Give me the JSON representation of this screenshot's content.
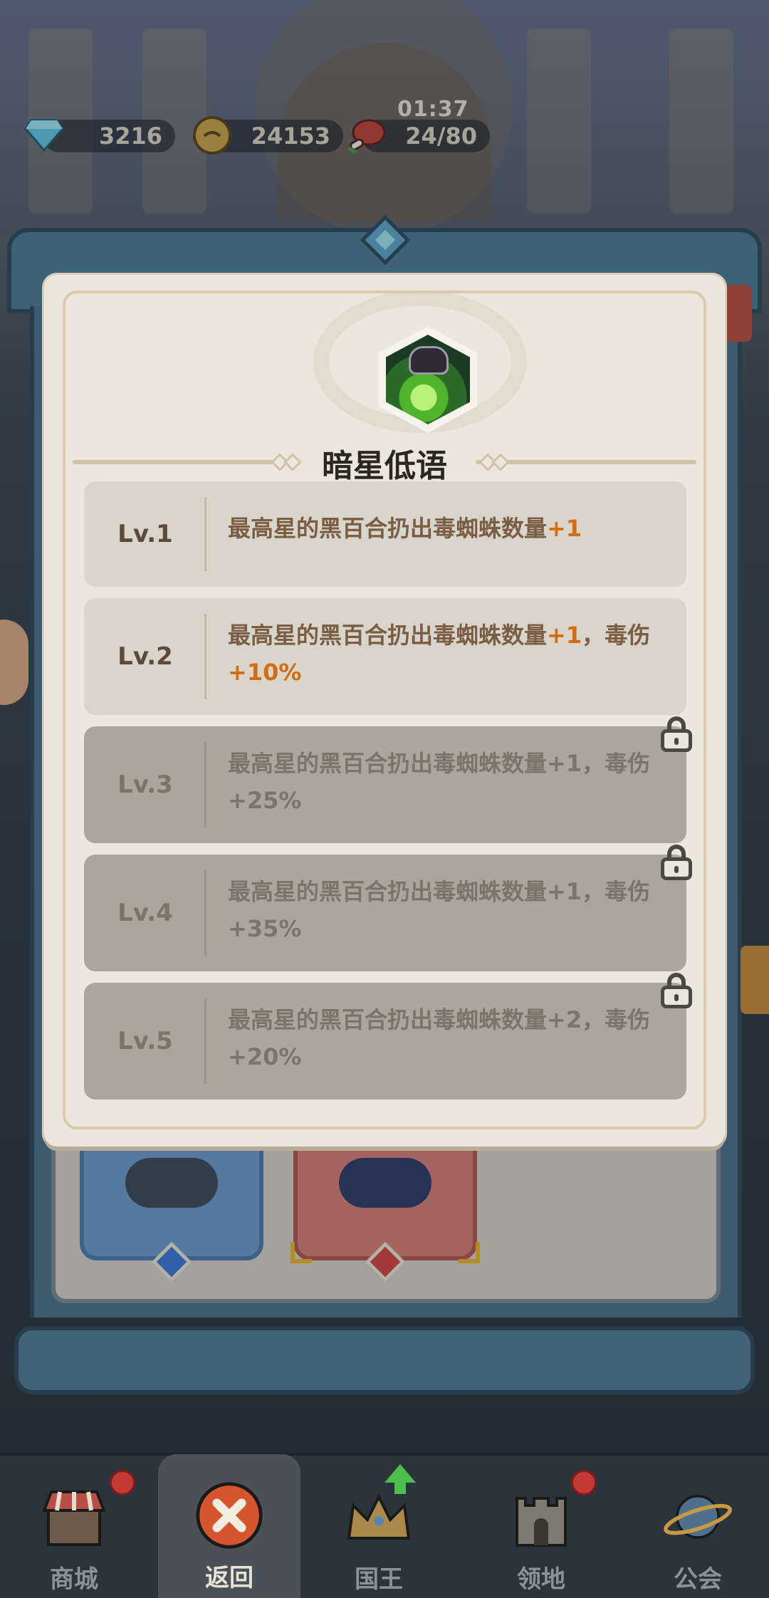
{
  "status": {
    "timer": "01:37",
    "gems": "3216",
    "coins": "24153",
    "stamina": "24/80"
  },
  "skill": {
    "title": "暗星低语",
    "icon": "dark-lily-skill-icon",
    "levels": [
      {
        "label": "Lv.1",
        "text": "最高星的黑百合扔出毒蜘蛛数量",
        "bonus": "+1",
        "tail_sep": "",
        "tail": "",
        "tail_bonus": "",
        "locked": false
      },
      {
        "label": "Lv.2",
        "text": "最高星的黑百合扔出毒蜘蛛数量",
        "bonus": "+1",
        "tail_sep": "，毒伤",
        "tail": "",
        "tail_bonus": "+10%",
        "locked": false
      },
      {
        "label": "Lv.3",
        "text": "最高星的黑百合扔出毒蜘蛛数量+1，毒伤+25%",
        "locked": true
      },
      {
        "label": "Lv.4",
        "text": "最高星的黑百合扔出毒蜘蛛数量+1，毒伤+35%",
        "locked": true
      },
      {
        "label": "Lv.5",
        "text": "最高星的黑百合扔出毒蜘蛛数量+2，毒伤+20%",
        "locked": true
      }
    ]
  },
  "nav": {
    "shop": "商城",
    "back": "返回",
    "king": "国王",
    "territory": "领地",
    "guild": "公会"
  },
  "colors": {
    "highlight": "#d46d12",
    "popup_bg": "#ebe7dc",
    "locked_row": "#aba69b"
  }
}
